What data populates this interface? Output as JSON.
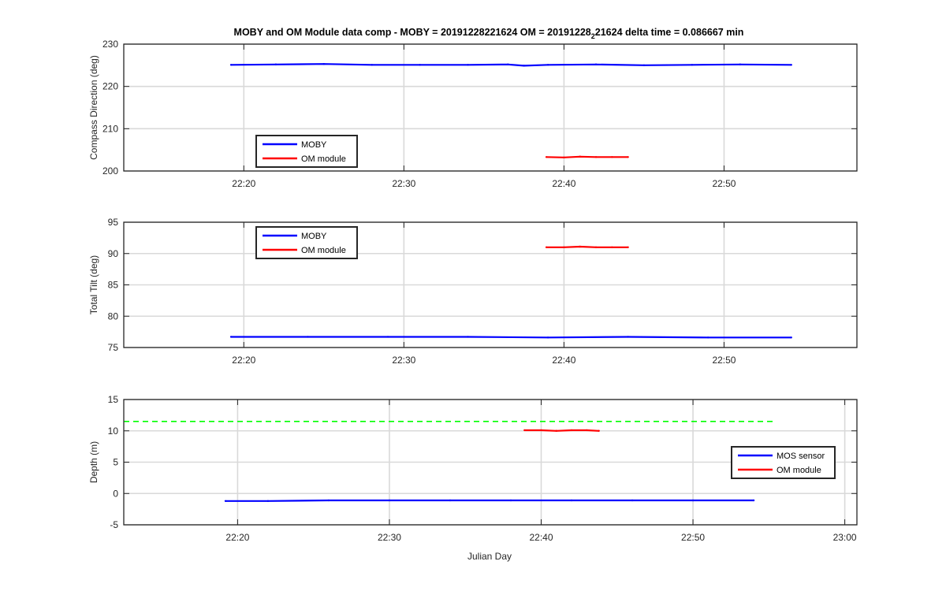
{
  "figure": {
    "title_main": "MOBY and OM Module data comp - MOBY = 20191228221624 OM = 20191228",
    "title_sub": "2",
    "title_rest": "21624 delta time = 0.086667 min",
    "xlabel": "Julian Day"
  },
  "colors": {
    "moby": "#0000ff",
    "om": "#ff0000",
    "reference": "#00ff00",
    "grid": "#d9d9d9",
    "axes": "#262626"
  },
  "chart_data": [
    {
      "type": "line",
      "ylabel": "Compass Direction (deg)",
      "xlim_minutes": [
        12.5,
        58.3
      ],
      "ylim": [
        200,
        230
      ],
      "yticks": [
        200,
        210,
        220,
        230
      ],
      "xticks": [
        {
          "label": "22:20",
          "minutes": 20
        },
        {
          "label": "22:30",
          "minutes": 30
        },
        {
          "label": "22:40",
          "minutes": 40
        },
        {
          "label": "22:50",
          "minutes": 50
        }
      ],
      "grid": true,
      "legend": {
        "placement": "lower-left",
        "entries": [
          "MOBY",
          "OM module"
        ]
      },
      "series": [
        {
          "name": "MOBY",
          "color_key": "moby",
          "x_minutes": [
            19.2,
            22,
            25,
            28,
            31,
            34,
            36.5,
            37.5,
            39,
            42,
            45,
            48,
            51,
            54.2
          ],
          "y": [
            225.1,
            225.2,
            225.3,
            225.1,
            225.1,
            225.1,
            225.2,
            224.9,
            225.1,
            225.2,
            225.0,
            225.1,
            225.2,
            225.1
          ]
        },
        {
          "name": "OM module",
          "color_key": "om",
          "x_minutes": [
            38.9,
            40,
            41,
            42,
            43,
            44
          ],
          "y": [
            203.3,
            203.2,
            203.4,
            203.3,
            203.3,
            203.3
          ]
        }
      ]
    },
    {
      "type": "line",
      "ylabel": "Total Tilt (deg)",
      "xlim_minutes": [
        12.5,
        58.3
      ],
      "ylim": [
        75,
        95
      ],
      "yticks": [
        75,
        80,
        85,
        90,
        95
      ],
      "xticks": [
        {
          "label": "22:20",
          "minutes": 20
        },
        {
          "label": "22:30",
          "minutes": 30
        },
        {
          "label": "22:40",
          "minutes": 40
        },
        {
          "label": "22:50",
          "minutes": 50
        }
      ],
      "grid": true,
      "legend": {
        "placement": "upper-left",
        "entries": [
          "MOBY",
          "OM module"
        ]
      },
      "series": [
        {
          "name": "MOBY",
          "color_key": "moby",
          "x_minutes": [
            19.2,
            24,
            29,
            34,
            39,
            44,
            49,
            54.2
          ],
          "y": [
            76.7,
            76.7,
            76.7,
            76.7,
            76.6,
            76.7,
            76.6,
            76.6
          ]
        },
        {
          "name": "OM module",
          "color_key": "om",
          "x_minutes": [
            38.9,
            40,
            41,
            42,
            43,
            44
          ],
          "y": [
            91.0,
            91.0,
            91.1,
            91.0,
            91.0,
            91.0
          ]
        }
      ]
    },
    {
      "type": "line",
      "ylabel": "Depth (m)",
      "xlim_minutes": [
        12.5,
        60.8
      ],
      "ylim": [
        -5,
        15
      ],
      "yticks": [
        -5,
        0,
        5,
        10,
        15
      ],
      "xticks": [
        {
          "label": "22:20",
          "minutes": 20
        },
        {
          "label": "22:30",
          "minutes": 30
        },
        {
          "label": "22:40",
          "minutes": 40
        },
        {
          "label": "22:50",
          "minutes": 50
        },
        {
          "label": "23:00",
          "minutes": 60
        }
      ],
      "grid": true,
      "legend": {
        "placement": "right",
        "entries": [
          "MOS sensor",
          "OM module"
        ]
      },
      "series": [
        {
          "name": "MOS sensor",
          "color_key": "moby",
          "x_minutes": [
            19.2,
            22,
            26,
            30,
            34,
            38,
            42,
            46,
            50,
            54
          ],
          "y": [
            -1.2,
            -1.2,
            -1.1,
            -1.1,
            -1.1,
            -1.1,
            -1.1,
            -1.1,
            -1.1,
            -1.1
          ]
        },
        {
          "name": "OM module",
          "color_key": "om",
          "x_minutes": [
            38.9,
            40,
            41,
            42,
            43,
            43.8
          ],
          "y": [
            10.1,
            10.1,
            10.0,
            10.1,
            10.1,
            10.0
          ]
        },
        {
          "name": "",
          "color_key": "reference",
          "dashed": true,
          "x_minutes": [
            12.5,
            55.3
          ],
          "y": [
            11.5,
            11.5
          ]
        }
      ]
    }
  ]
}
